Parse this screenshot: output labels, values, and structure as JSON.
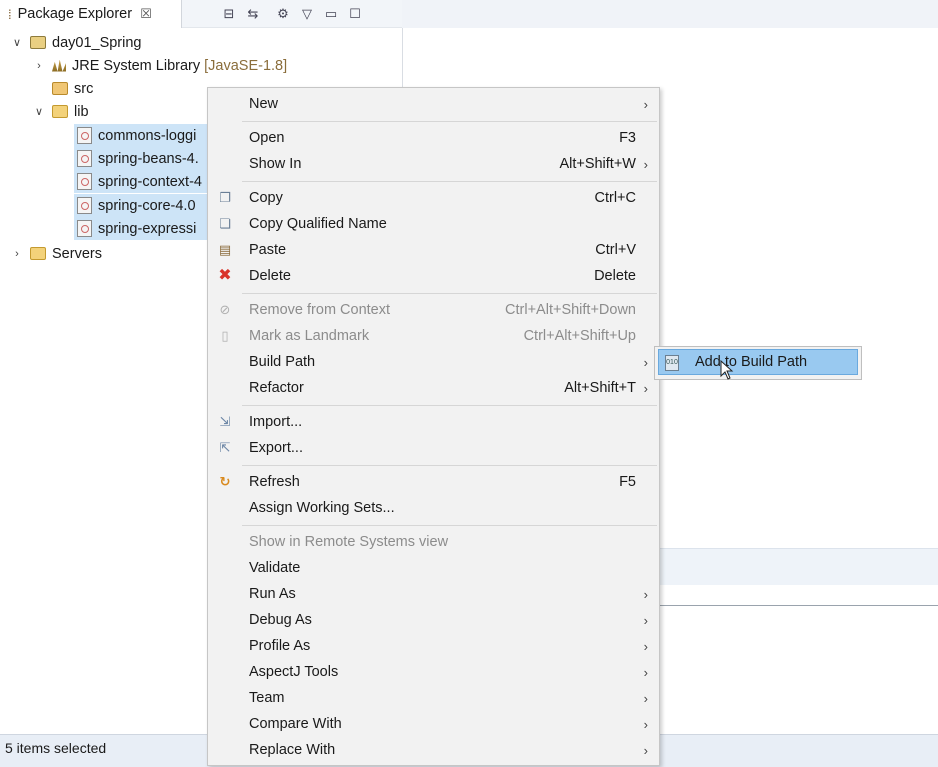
{
  "explorer": {
    "tab_title": "Package Explorer",
    "tab_close": "☒",
    "toolbar_icons": [
      "collapse-all-icon",
      "link-editor-icon",
      "filter-icon",
      "view-menu-icon",
      "minimize-icon",
      "maximize-icon"
    ],
    "tree": {
      "project": "day01_Spring",
      "jre_label": "JRE System Library",
      "jre_version": "[JavaSE-1.8]",
      "src": "src",
      "lib": "lib",
      "jars": [
        "commons-loggi",
        "spring-beans-4.",
        "spring-context-4",
        "spring-core-4.0",
        "spring-expressi"
      ],
      "servers": "Servers"
    }
  },
  "status": {
    "text": "5 items selected"
  },
  "context_menu": {
    "items": [
      {
        "label": "New",
        "accel": "",
        "submenu": true,
        "disabled": false,
        "icon": ""
      },
      {
        "label": "Open",
        "accel": "F3",
        "submenu": false,
        "disabled": false,
        "icon": ""
      },
      {
        "label": "Show In",
        "accel": "Alt+Shift+W",
        "submenu": true,
        "disabled": false,
        "icon": ""
      },
      {
        "label": "Copy",
        "accel": "Ctrl+C",
        "submenu": false,
        "disabled": false,
        "icon": "copy-icon"
      },
      {
        "label": "Copy Qualified Name",
        "accel": "",
        "submenu": false,
        "disabled": false,
        "icon": "copy-qualified-icon"
      },
      {
        "label": "Paste",
        "accel": "Ctrl+V",
        "submenu": false,
        "disabled": false,
        "icon": "paste-icon"
      },
      {
        "label": "Delete",
        "accel": "Delete",
        "submenu": false,
        "disabled": false,
        "icon": "delete-icon"
      },
      {
        "label": "Remove from Context",
        "accel": "Ctrl+Alt+Shift+Down",
        "submenu": false,
        "disabled": true,
        "icon": "remove-context-icon"
      },
      {
        "label": "Mark as Landmark",
        "accel": "Ctrl+Alt+Shift+Up",
        "submenu": false,
        "disabled": true,
        "icon": "landmark-icon"
      },
      {
        "label": "Build Path",
        "accel": "",
        "submenu": true,
        "disabled": false,
        "icon": ""
      },
      {
        "label": "Refactor",
        "accel": "Alt+Shift+T",
        "submenu": true,
        "disabled": false,
        "icon": ""
      },
      {
        "label": "Import...",
        "accel": "",
        "submenu": false,
        "disabled": false,
        "icon": "import-icon"
      },
      {
        "label": "Export...",
        "accel": "",
        "submenu": false,
        "disabled": false,
        "icon": "export-icon"
      },
      {
        "label": "Refresh",
        "accel": "F5",
        "submenu": false,
        "disabled": false,
        "icon": "refresh-icon"
      },
      {
        "label": "Assign Working Sets...",
        "accel": "",
        "submenu": false,
        "disabled": false,
        "icon": ""
      },
      {
        "label": "Show in Remote Systems view",
        "accel": "",
        "submenu": false,
        "disabled": true,
        "icon": ""
      },
      {
        "label": "Validate",
        "accel": "",
        "submenu": false,
        "disabled": false,
        "icon": ""
      },
      {
        "label": "Run As",
        "accel": "",
        "submenu": true,
        "disabled": false,
        "icon": ""
      },
      {
        "label": "Debug As",
        "accel": "",
        "submenu": true,
        "disabled": false,
        "icon": ""
      },
      {
        "label": "Profile As",
        "accel": "",
        "submenu": true,
        "disabled": false,
        "icon": ""
      },
      {
        "label": "AspectJ Tools",
        "accel": "",
        "submenu": true,
        "disabled": false,
        "icon": ""
      },
      {
        "label": "Team",
        "accel": "",
        "submenu": true,
        "disabled": false,
        "icon": ""
      },
      {
        "label": "Compare With",
        "accel": "",
        "submenu": true,
        "disabled": false,
        "icon": ""
      },
      {
        "label": "Replace With",
        "accel": "",
        "submenu": true,
        "disabled": false,
        "icon": ""
      }
    ]
  },
  "submenu": {
    "item_label": "Add to Build Path",
    "item_icon": "jar-add-icon"
  },
  "colors": {
    "selection": "#99c9f0",
    "tree_selection": "#cde4f7",
    "menu_bg": "#f2f2f2",
    "delete_red": "#d9342b"
  }
}
